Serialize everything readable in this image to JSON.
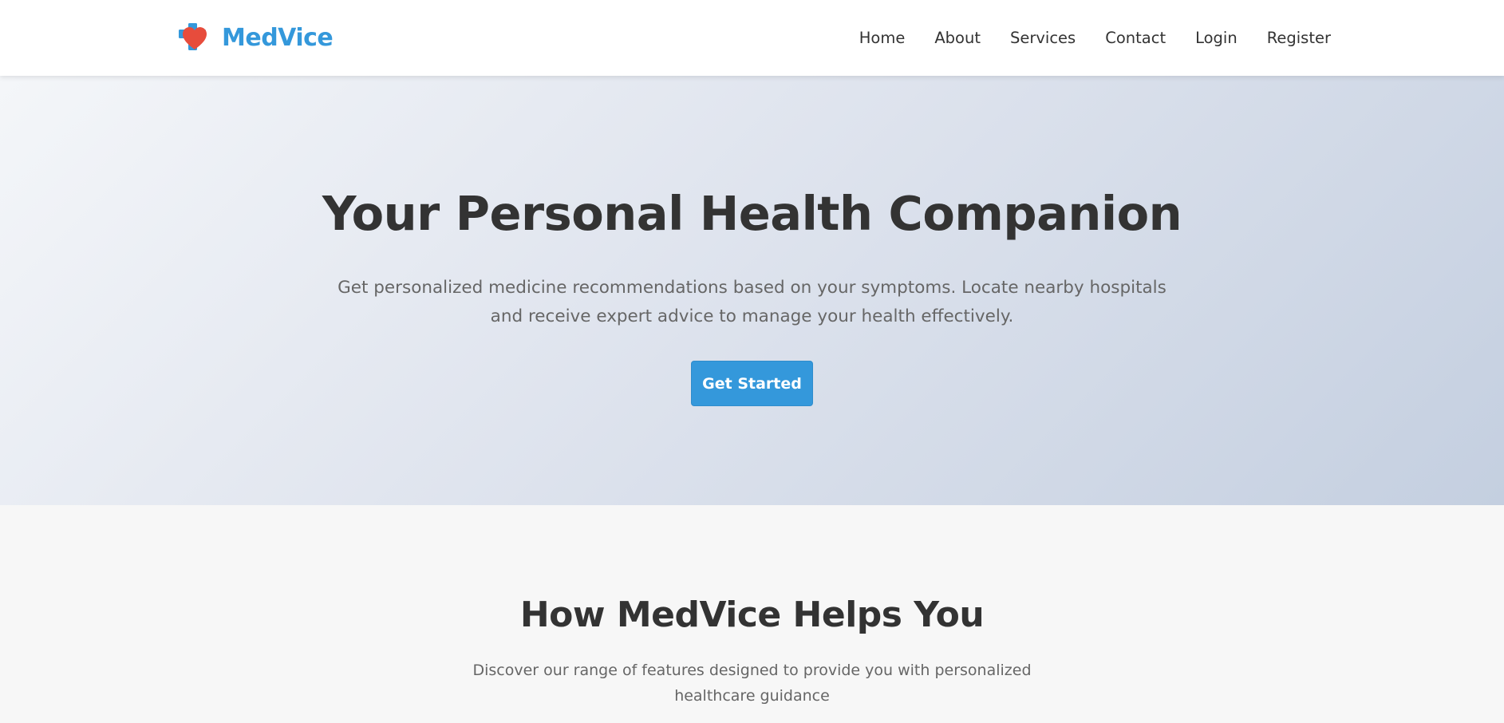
{
  "brand": {
    "name": "MedVice",
    "icon": "heart-medical-cross-icon",
    "colors": {
      "primary": "#3498db",
      "heart": "#e74c3c"
    }
  },
  "nav": {
    "items": [
      {
        "label": "Home"
      },
      {
        "label": "About"
      },
      {
        "label": "Services"
      },
      {
        "label": "Contact"
      },
      {
        "label": "Login"
      },
      {
        "label": "Register"
      }
    ]
  },
  "hero": {
    "title": "Your Personal Health Companion",
    "subtitle": "Get personalized medicine recommendations based on your symptoms. Locate nearby hospitals and receive expert advice to manage your health effectively.",
    "cta_label": "Get Started"
  },
  "features": {
    "title": "How MedVice Helps You",
    "subtitle": "Discover our range of features designed to provide you with personalized healthcare guidance"
  }
}
